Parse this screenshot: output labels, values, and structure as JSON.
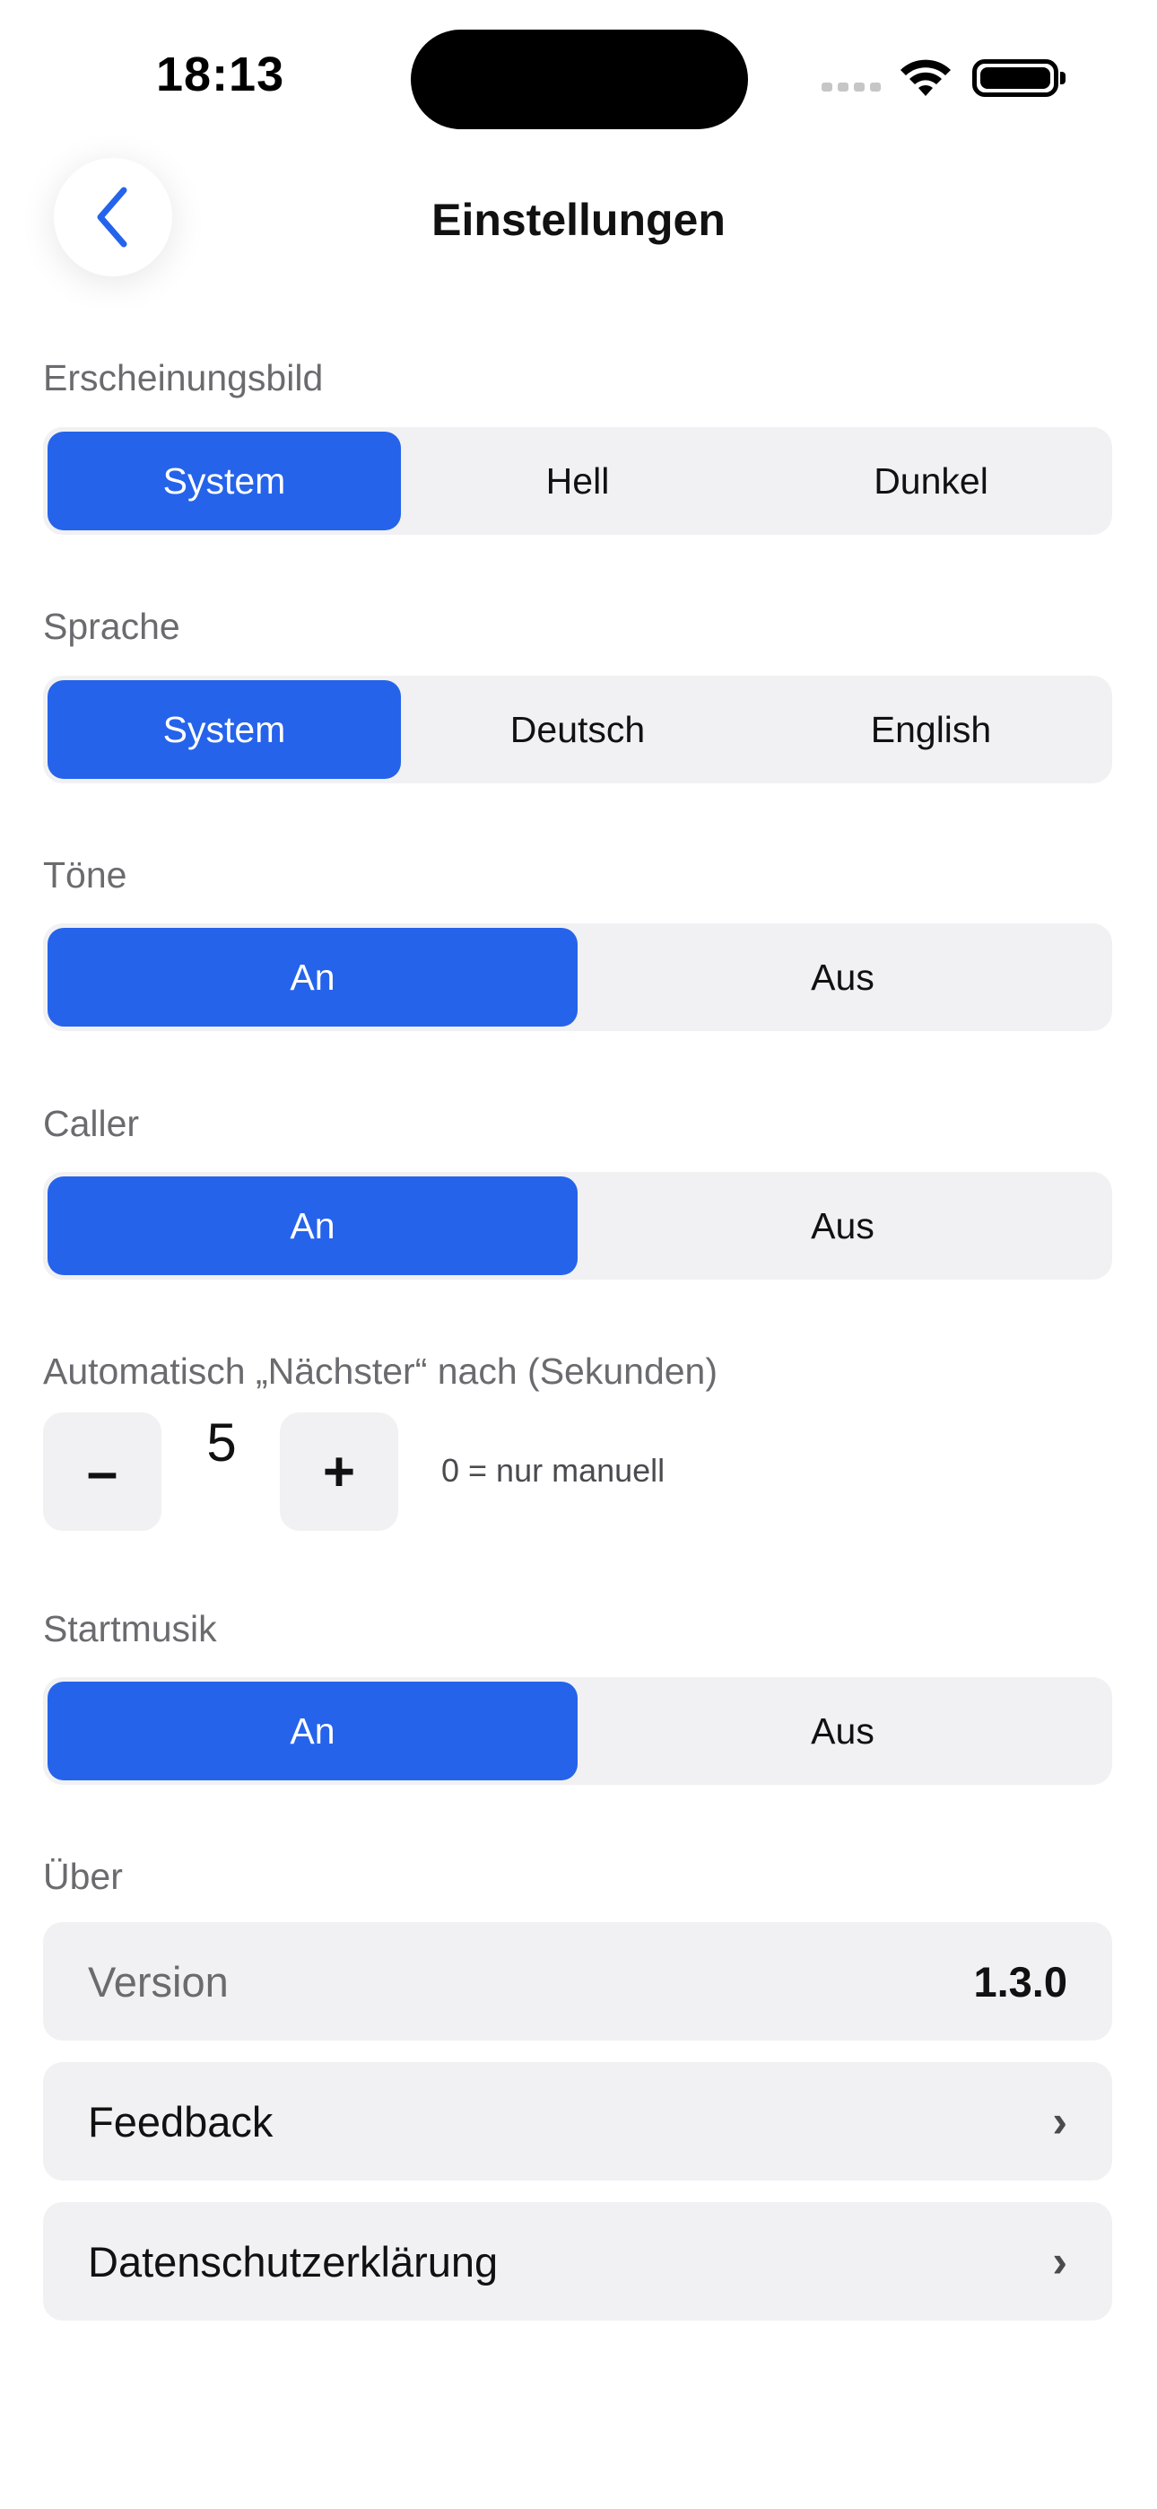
{
  "status_bar": {
    "time": "18:13"
  },
  "header": {
    "title": "Einstellungen"
  },
  "appearance": {
    "label": "Erscheinungsbild",
    "options": [
      "System",
      "Hell",
      "Dunkel"
    ],
    "selected": "System"
  },
  "language": {
    "label": "Sprache",
    "options": [
      "System",
      "Deutsch",
      "English"
    ],
    "selected": "System"
  },
  "tones": {
    "label": "Töne",
    "options": [
      "An",
      "Aus"
    ],
    "selected": "An"
  },
  "caller": {
    "label": "Caller",
    "options": [
      "An",
      "Aus"
    ],
    "selected": "An"
  },
  "auto_next": {
    "label": "Automatisch „Nächster“ nach (Sekunden)",
    "minus": "–",
    "value": "5",
    "plus": "+",
    "hint": "0 = nur manuell"
  },
  "start_music": {
    "label": "Startmusik",
    "options": [
      "An",
      "Aus"
    ],
    "selected": "An"
  },
  "about": {
    "label": "Über",
    "version_label": "Version",
    "version_value": "1.3.0",
    "feedback_label": "Feedback",
    "privacy_label": "Datenschutzerklärung"
  },
  "colors": {
    "accent": "#2563eb",
    "control_bg": "#f1f1f3",
    "label": "#6b6b6f"
  }
}
